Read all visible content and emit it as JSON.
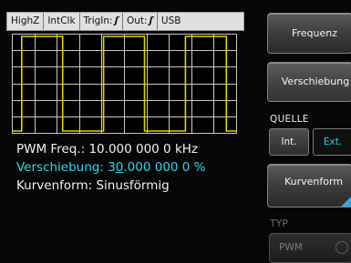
{
  "status_bar": {
    "items": [
      {
        "label": "HighZ"
      },
      {
        "label": "IntClk"
      },
      {
        "label": "TrigIn:",
        "glyph": "ʃ"
      },
      {
        "label": "Out:",
        "glyph": "ʃ"
      },
      {
        "label": "USB"
      }
    ]
  },
  "waveform": {
    "trace_color": "#e4d400",
    "grid_color": "#c8c8c8",
    "duty_cycle": 0.5,
    "icon": "pulse-waveform-icon"
  },
  "info": {
    "frequency": "PWM Freq.: 10.000 000 0 kHz",
    "offset_prefix": "Verschiebung: 3",
    "offset_cursor": "0",
    "offset_suffix": ".000 000 0 %",
    "curve": "Kurvenform: Sinusförmig"
  },
  "softkeys": {
    "frequenz": "Frequenz",
    "verschiebung": "Verschiebung",
    "kurvenform": "Kurvenform"
  },
  "source": {
    "label": "QUELLE",
    "int": "Int.",
    "ext": "Ext.",
    "selected": "Ext."
  },
  "type": {
    "label": "TYP",
    "value": "PWM"
  },
  "colors": {
    "accent": "#2fd8ec",
    "trace": "#e4d400",
    "softkey_corner": "#2fa8e6"
  }
}
